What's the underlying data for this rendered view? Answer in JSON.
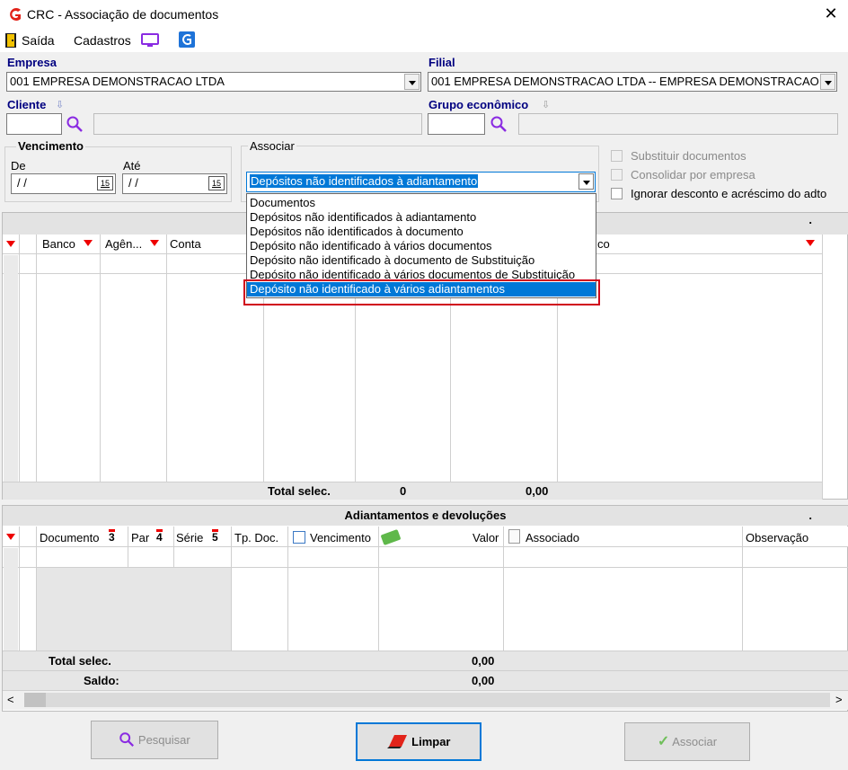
{
  "window": {
    "title": "CRC - Associação de documentos",
    "close_glyph": "✕"
  },
  "menu": {
    "saida": "Saída",
    "cadastros": "Cadastros"
  },
  "empresa": {
    "label": "Empresa",
    "value": "001 EMPRESA DEMONSTRACAO LTDA"
  },
  "filial": {
    "label": "Filial",
    "value": "001 EMPRESA DEMONSTRACAO LTDA -- EMPRESA DEMONSTRACAO"
  },
  "cliente": {
    "label": "Cliente"
  },
  "grupo": {
    "label": "Grupo econômico"
  },
  "vencimento": {
    "title": "Vencimento",
    "de_label": "De",
    "ate_label": "Até",
    "de_value": " / /",
    "ate_value": " / /",
    "cal_glyph": "15"
  },
  "associar": {
    "title": "Associar",
    "selected": "Depósitos não identificados à adiantamento",
    "options": [
      "Documentos",
      "Depósitos não identificados à adiantamento",
      "Depósitos não identificados à documento",
      "Depósito não identificado à vários documentos",
      "Depósito não identificado à documento de Substituição",
      "Depósito não identificado à vários documentos de Substituição",
      "Depósito não identificado à vários adiantamentos"
    ]
  },
  "options": {
    "substituir": "Substituir documentos",
    "consolidar": "Consolidar por empresa",
    "ignorar": "Ignorar desconto e acréscimo do adto"
  },
  "grid1": {
    "columns": {
      "banco": "Banco",
      "agencia": "Agên...",
      "conta": "Conta",
      "last": "co"
    },
    "total_label": "Total selec.",
    "total_count": "0",
    "total_value": "0,00",
    "dot": "."
  },
  "grid2": {
    "band_title": "Adiantamentos e devoluções",
    "dot": ".",
    "columns": {
      "documento": "Documento",
      "documento_sort": "3",
      "par": "Par",
      "par_sort": "4",
      "serie": "Série",
      "serie_sort": "5",
      "tpdoc": "Tp. Doc.",
      "vencimento": "Vencimento",
      "valor": "Valor",
      "associado": "Associado",
      "observacao": "Observação"
    },
    "total_label": "Total selec.",
    "total_value": "0,00",
    "saldo_label": "Saldo:",
    "saldo_value": "0,00"
  },
  "scroll": {
    "left": "<",
    "right": ">"
  },
  "buttons": {
    "pesquisar": "Pesquisar",
    "limpar": "Limpar",
    "associar": "Associar"
  },
  "colors": {
    "accent": "#0078d7",
    "label_blue": "#000080",
    "highlight_border": "#d0021b"
  }
}
